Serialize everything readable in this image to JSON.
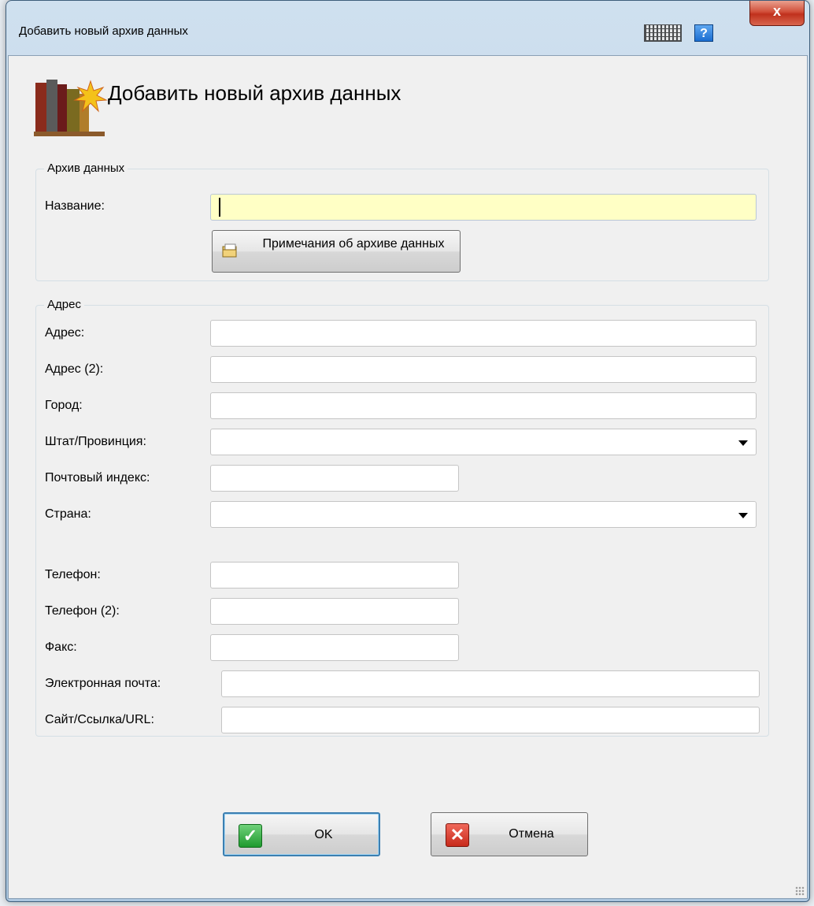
{
  "window": {
    "title": "Добавить новый архив данных",
    "close_glyph": "x",
    "help_glyph": "?"
  },
  "header": {
    "title": "Добавить новый архив данных",
    "icon": "books-archive-icon"
  },
  "archive_group": {
    "title": "Архив данных",
    "name_label": "Название:",
    "name_value": "",
    "notes_button": "Примечания об архиве данных"
  },
  "address_group": {
    "title": "Адрес",
    "labels": {
      "address": "Адрес:",
      "address2": "Адрес (2):",
      "city": "Город:",
      "state": "Штат/Провинция:",
      "postal": "Почтовый индекс:",
      "country": "Страна:",
      "phone": "Телефон:",
      "phone2": "Телефон (2):",
      "fax": "Факс:",
      "email": "Электронная почта:",
      "website": "Сайт/Ссылка/URL:"
    }
  },
  "buttons": {
    "ok": "OK",
    "cancel": "Отмена"
  },
  "colors": {
    "name_field_bg": "#ffffc5",
    "ok_icon": "#1f9a2f",
    "cancel_icon": "#c72a1b",
    "close_button": "#c0311d"
  }
}
